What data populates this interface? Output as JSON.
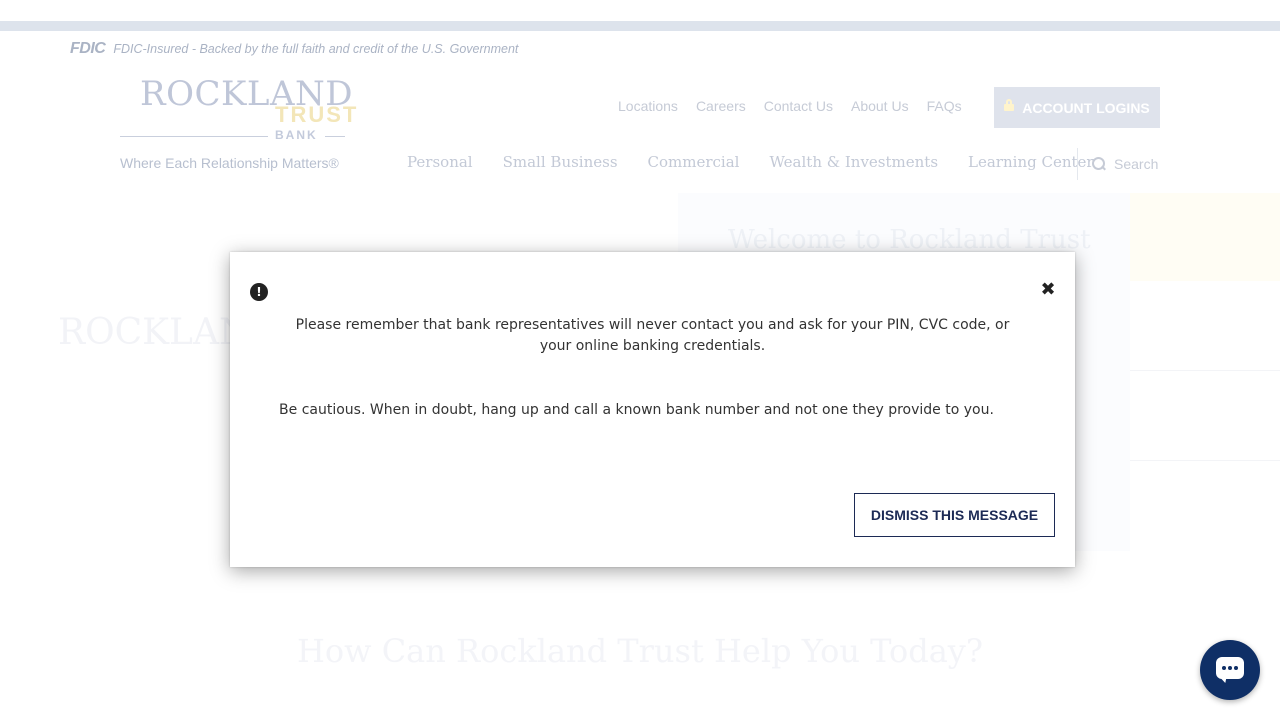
{
  "fdic": {
    "logo": "FDIC",
    "text": "FDIC-Insured - Backed by the full faith and credit of the U.S. Government"
  },
  "logo": {
    "name": "ROCKLAND",
    "trust": "TRUST",
    "bank": "BANK",
    "tagline": "Where Each Relationship Matters®"
  },
  "utility_nav": [
    "Locations",
    "Careers",
    "Contact Us",
    "About Us",
    "FAQs"
  ],
  "account_logins_label": "ACCOUNT LOGINS",
  "main_nav": [
    "Personal",
    "Small Business",
    "Commercial",
    "Wealth & Investments",
    "Learning Center"
  ],
  "search": {
    "placeholder": "Search"
  },
  "modal": {
    "message_1": "Please remember that bank representatives will never contact you and ask for your PIN, CVC code, or your online banking credentials.",
    "message_2": "Be cautious. When in doubt, hang up and call a known bank number and not one they provide to you.",
    "dismiss_label": "DISMISS THIS MESSAGE",
    "alert_glyph": "!",
    "close_glyph": "✖"
  },
  "background": {
    "hero_heading": "Welcome to Rockland Trust",
    "help_heading": "How Can Rockland Trust Help You Today?"
  },
  "colors": {
    "brand_navy": "#1c2a55",
    "chat_bubble": "#0f2f66"
  },
  "icons": {
    "lock": "lock-icon",
    "search": "search-icon",
    "alert": "exclamation-circle-icon",
    "close": "close-icon",
    "chat": "chat-bubble-icon"
  }
}
